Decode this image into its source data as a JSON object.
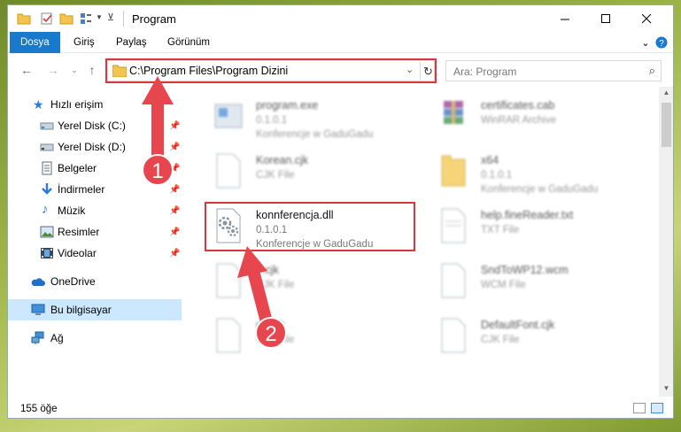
{
  "window": {
    "title": "Program",
    "minimize_icon": "minimize-icon",
    "maximize_icon": "maximize-icon",
    "close_icon": "close-icon"
  },
  "ribbon": {
    "tabs": [
      {
        "label": "Dosya",
        "active": true
      },
      {
        "label": "Giriş",
        "active": false
      },
      {
        "label": "Paylaş",
        "active": false
      },
      {
        "label": "Görünüm",
        "active": false
      }
    ],
    "accent": "#1979ca"
  },
  "address": {
    "path": "C:\\Program Files\\Program Dizini",
    "search_placeholder": "Ara: Program"
  },
  "sidebar": {
    "items": [
      {
        "label": "Hızlı erişim",
        "icon": "star-icon",
        "pinned": false
      },
      {
        "label": "Yerel Disk (C:)",
        "icon": "drive-icon",
        "pinned": true
      },
      {
        "label": "Yerel Disk (D:)",
        "icon": "drive-icon",
        "pinned": true
      },
      {
        "label": "Belgeler",
        "icon": "document-icon",
        "pinned": true
      },
      {
        "label": "İndirmeler",
        "icon": "download-icon",
        "pinned": true
      },
      {
        "label": "Müzik",
        "icon": "music-icon",
        "pinned": true
      },
      {
        "label": "Resimler",
        "icon": "picture-icon",
        "pinned": true
      },
      {
        "label": "Videolar",
        "icon": "video-icon",
        "pinned": true
      },
      {
        "label": "OneDrive",
        "icon": "cloud-icon",
        "pinned": false
      },
      {
        "label": "Bu bilgisayar",
        "icon": "computer-icon",
        "pinned": false,
        "selected": true
      },
      {
        "label": "Ağ",
        "icon": "network-icon",
        "pinned": false
      }
    ]
  },
  "files": [
    {
      "name": "program.exe",
      "line1": "0.1.0.1",
      "line2": "Konferencje w GaduGadu",
      "blurred": true
    },
    {
      "name": "certificates.cab",
      "line1": "WinRAR Archive",
      "line2": "",
      "blurred": true
    },
    {
      "name": "Korean.cjk",
      "line1": "CJK File",
      "line2": "",
      "blurred": true
    },
    {
      "name": "x64",
      "line1": "0.1.0.1",
      "line2": "Konferencje w GaduGadu",
      "blurred": true
    },
    {
      "name": "konnferencja.dll",
      "line1": "0.1.0.1",
      "line2": "Konferencje w GaduGadu",
      "blurred": false
    },
    {
      "name": "help.fineReader.txt",
      "line1": "TXT File",
      "line2": "",
      "blurred": true
    },
    {
      "name": "?.cjk",
      "line1": "CJK File",
      "line2": "",
      "blurred": true
    },
    {
      "name": "SndToWP12.wcm",
      "line1": "WCM File",
      "line2": "",
      "blurred": true
    },
    {
      "name": "gb.cjk",
      "line1": "CJK File",
      "line2": "",
      "blurred": true
    },
    {
      "name": "DefaultFont.cjk",
      "line1": "CJK File",
      "line2": "",
      "blurred": true
    }
  ],
  "status": {
    "count": "155 öğe"
  },
  "annotations": {
    "step1": "1",
    "step2": "2",
    "color": "#e8464e"
  }
}
